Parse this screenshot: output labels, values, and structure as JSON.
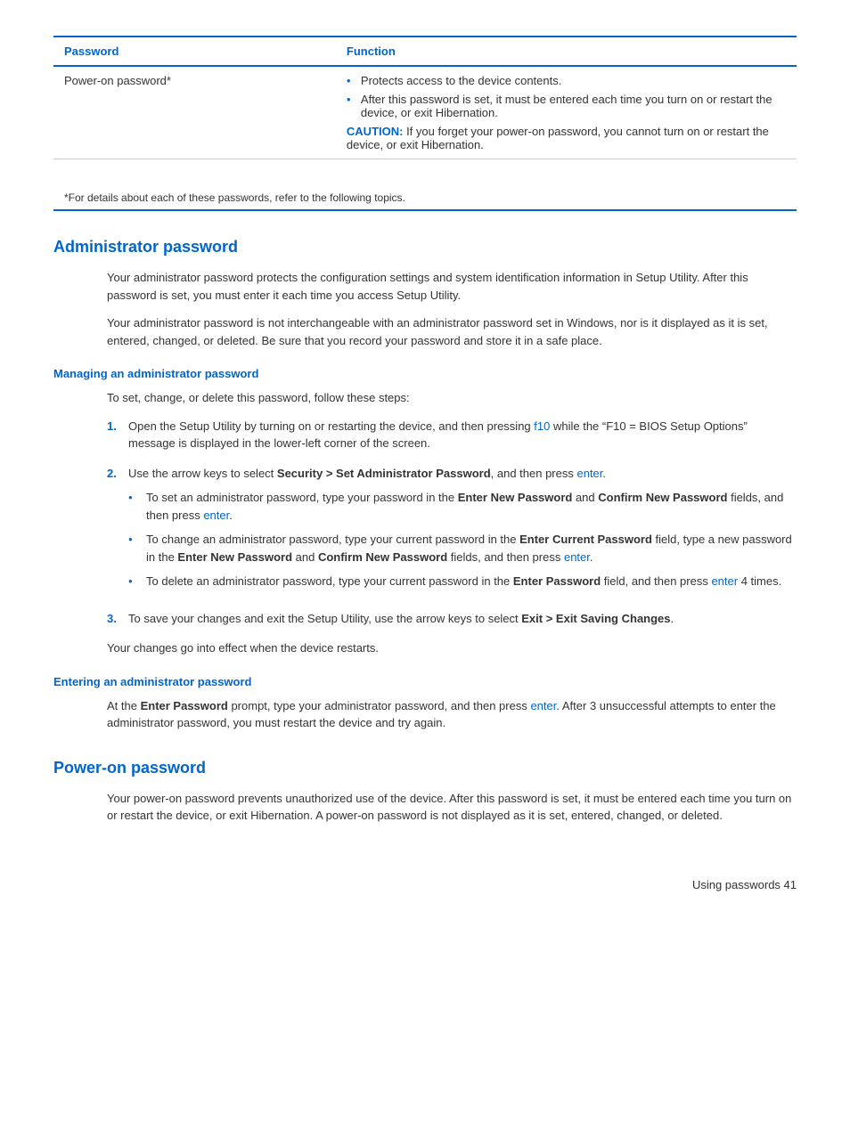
{
  "table": {
    "headers": {
      "col1": "Password",
      "col2": "Function"
    },
    "rows": [
      {
        "password": "Power-on password*",
        "bullets": [
          "Protects access to the device contents.",
          "After this password is set, it must be entered each time you turn on or restart the device, or exit Hibernation."
        ],
        "caution": {
          "label": "CAUTION:",
          "text": "  If you forget your power-on password, you cannot turn on or restart the device, or exit Hibernation."
        }
      }
    ],
    "footnote": "*For details about each of these passwords, refer to the following topics."
  },
  "admin_section": {
    "heading": "Administrator password",
    "para1": "Your administrator password protects the configuration settings and system identification information in Setup Utility. After this password is set, you must enter it each time you access Setup Utility.",
    "para2": "Your administrator password is not interchangeable with an administrator password set in Windows, nor is it displayed as it is set, entered, changed, or deleted. Be sure that you record your password and store it in a safe place.",
    "managing": {
      "heading": "Managing an administrator password",
      "intro": "To set, change, or delete this password, follow these steps:",
      "steps": [
        {
          "num": "1.",
          "text_before": "Open the Setup Utility by turning on or restarting the device, and then pressing ",
          "link1": "f10",
          "text_mid": " while the “F10 = BIOS Setup Options” message is displayed in the lower-left corner of the screen.",
          "link2": null
        },
        {
          "num": "2.",
          "text_before": "Use the arrow keys to select ",
          "bold_text": "Security > Set Administrator Password",
          "text_mid": ", and then press ",
          "link1": "enter",
          "text_end": ".",
          "sub_bullets": [
            {
              "text_before": "To set an administrator password, type your password in the ",
              "bold1": "Enter New Password",
              "text_mid": " and ",
              "bold2": "Confirm New Password",
              "text_end_before": " fields, and then press ",
              "link": "enter",
              "text_end": "."
            },
            {
              "text_before": "To change an administrator password, type your current password in the ",
              "bold1": "Enter Current Password",
              "text_mid1": " field, type a new password in the ",
              "bold2": "Enter New Password",
              "text_mid2": " and ",
              "bold3": "Confirm New Password",
              "text_end_before": " fields, and then press ",
              "link": "enter",
              "text_end": "."
            },
            {
              "text_before": "To delete an administrator password, type your current password in the ",
              "bold1": "Enter Password",
              "text_mid": " field, and then press ",
              "link": "enter",
              "text_end": " 4 times."
            }
          ]
        },
        {
          "num": "3.",
          "text_before": "To save your changes and exit the Setup Utility, use the arrow keys to select ",
          "bold_text": "Exit > Exit Saving Changes",
          "text_end": "."
        }
      ],
      "after_steps": "Your changes go into effect when the device restarts."
    },
    "entering": {
      "heading": "Entering an administrator password",
      "text_before": "At the ",
      "bold1": "Enter Password",
      "text_mid": " prompt, type your administrator password, and then press ",
      "link": "enter",
      "text_end": ". After 3 unsuccessful attempts to enter the administrator password, you must restart the device and try again."
    }
  },
  "power_on_section": {
    "heading": "Power-on password",
    "para": "Your power-on password prevents unauthorized use of the device. After this password is set, it must be entered each time you turn on or restart the device, or exit Hibernation. A power-on password is not displayed as it is set, entered, changed, or deleted."
  },
  "footer": {
    "text": "Using passwords    41"
  }
}
